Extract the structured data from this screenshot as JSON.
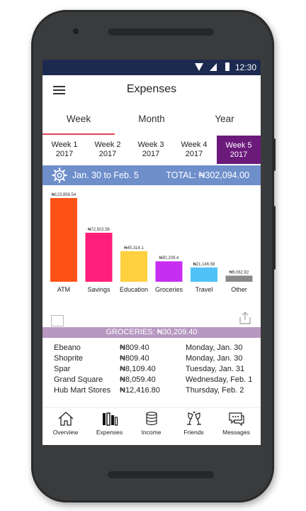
{
  "status": {
    "time": "12:30"
  },
  "app": {
    "title": "Expenses"
  },
  "tabs": [
    {
      "label": "Week",
      "active": true
    },
    {
      "label": "Month",
      "active": false
    },
    {
      "label": "Year",
      "active": false
    }
  ],
  "weeks": [
    {
      "line1": "Week 1",
      "line2": "2017",
      "active": false
    },
    {
      "line1": "Week 2",
      "line2": "2017",
      "active": false
    },
    {
      "line1": "Week 3",
      "line2": "2017",
      "active": false
    },
    {
      "line1": "Week 4",
      "line2": "2017",
      "active": false
    },
    {
      "line1": "Week 5",
      "line2": "2017",
      "active": true
    }
  ],
  "summary": {
    "range": "Jan. 30 to Feb. 5",
    "total": "TOTAL: ₦302,094.00"
  },
  "chart_data": {
    "type": "bar",
    "categories": [
      "ATM",
      "Savings",
      "Education",
      "Groceries",
      "Travel",
      "Other"
    ],
    "values": [
      123858.54,
      72502.56,
      45314.1,
      30209.4,
      21146.58,
      9062.82
    ],
    "value_labels": [
      "₦123,858.54",
      "₦72,502.56",
      "₦45,314.1",
      "₦30,209.4",
      "₦21,146.58",
      "₦9,062.82"
    ],
    "colors": [
      "#ff5216",
      "#ff1f7a",
      "#ffd040",
      "#c62ef2",
      "#4fc3f7",
      "#8a8a8a"
    ],
    "ylim": [
      0,
      123858.54
    ]
  },
  "selected_category": {
    "header": "GROCERIES: ₦30,209.40"
  },
  "transactions": [
    {
      "store": "Ebeano",
      "amount": "₦809.40",
      "date": "Monday, Jan. 30"
    },
    {
      "store": "Shoprite",
      "amount": "₦809.40",
      "date": "Monday, Jan. 30"
    },
    {
      "store": "Spar",
      "amount": "₦8,109.40",
      "date": "Tuesday, Jan. 31"
    },
    {
      "store": "Grand Square",
      "amount": "₦8,059.40",
      "date": "Wednesday, Feb. 1"
    },
    {
      "store": "Hub Mart Stores",
      "amount": "₦12,416.80",
      "date": "Thursday, Feb. 2"
    }
  ],
  "nav": [
    {
      "label": "Overview",
      "icon": "home-icon"
    },
    {
      "label": "Expenses",
      "icon": "expenses-icon"
    },
    {
      "label": "Income",
      "icon": "coins-icon"
    },
    {
      "label": "Friends",
      "icon": "cheers-icon"
    },
    {
      "label": "Messages",
      "icon": "chat-icon"
    }
  ]
}
